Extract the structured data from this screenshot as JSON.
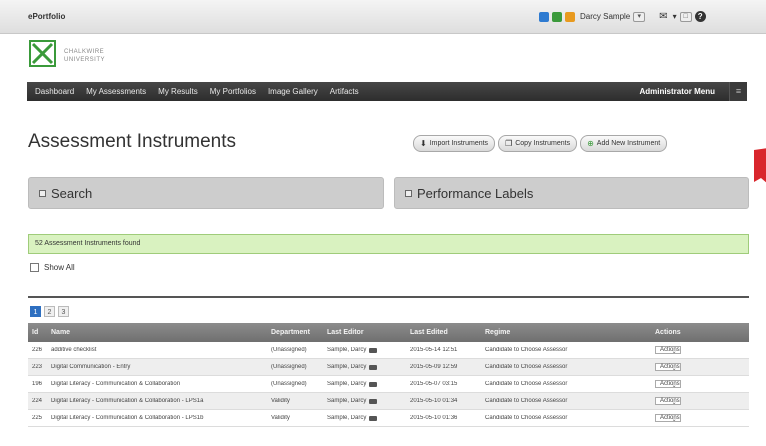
{
  "topbar": {
    "app_title": "ePortfolio",
    "user_name": "Darcy Sample",
    "user_menu_caret": "▾",
    "inbox_label": "▾",
    "help_glyph": "?",
    "user_icon_glyph": "☺",
    "inbox_icon_glyph": "✉",
    "window_icon_glyph": "□"
  },
  "logo": {
    "line1": "CHALKWIRE",
    "line2": "UNIVERSITY",
    "color": "#3a9a3a"
  },
  "nav": {
    "items": [
      "Dashboard",
      "My Assessments",
      "My Results",
      "My Portfolios",
      "Image Gallery",
      "Artifacts"
    ],
    "admin_menu": "Administrator Menu",
    "burger_glyph": "≡"
  },
  "page": {
    "title": "Assessment Instruments",
    "import_label": "Import Instruments",
    "copy_label": "Copy Instruments",
    "add_label": "Add New Instrument",
    "import_icon": "⬇",
    "copy_icon": "❐",
    "add_icon": "⊕",
    "flag_color": "#d9262c"
  },
  "panels": {
    "search_label": "Search",
    "performance_label": "Performance Labels"
  },
  "results": {
    "found_text": "52 Assessment Instruments found",
    "show_all_label": "Show All"
  },
  "pagination": {
    "pages": [
      "1",
      "2",
      "3"
    ],
    "active_page": "1"
  },
  "table": {
    "headers": {
      "id": "Id",
      "name": "Name",
      "department": "Department",
      "last_editor": "Last Editor",
      "last_edited": "Last Edited",
      "regime": "Regime",
      "actions": "Actions"
    },
    "rows": [
      {
        "id": "226",
        "name": "additive checklist",
        "department": "(Unassigned)",
        "editor": "Sample, Darcy",
        "edited": "2015-05-14 12:51",
        "regime": "Candidate to Choose Assessor",
        "action": "Actions"
      },
      {
        "id": "223",
        "name": "Digital Communication - Entry",
        "department": "(Unassigned)",
        "editor": "Sample, Darcy",
        "edited": "2015-05-09 12:59",
        "regime": "Candidate to Choose Assessor",
        "action": "Actions"
      },
      {
        "id": "196",
        "name": "Digital Literacy - Communication & Collaboration",
        "department": "(Unassigned)",
        "editor": "Sample, Darcy",
        "edited": "2015-05-07 03:15",
        "regime": "Candidate to Choose Assessor",
        "action": "Actions"
      },
      {
        "id": "224",
        "name": "Digital Literacy - Communication & Collaboration - LPS1a",
        "department": "Validity",
        "editor": "Sample, Darcy",
        "edited": "2015-05-10 01:34",
        "regime": "Candidate to Choose Assessor",
        "action": "Actions"
      },
      {
        "id": "225",
        "name": "Digital Literacy - Communication & Collaboration - LPS1b",
        "department": "Validity",
        "editor": "Sample, Darcy",
        "edited": "2015-05-10 01:36",
        "regime": "Candidate to Choose Assessor",
        "action": "Actions"
      }
    ],
    "select_caret": "⌄"
  }
}
